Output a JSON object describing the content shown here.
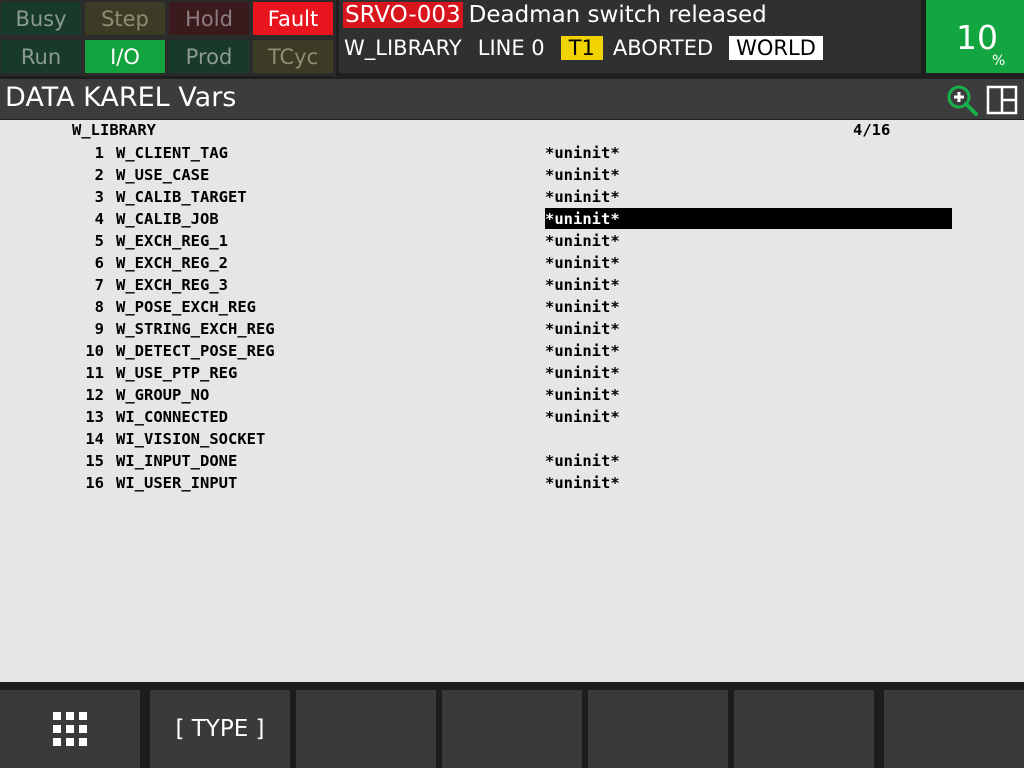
{
  "lamps": [
    {
      "label": "Busy",
      "state": "off"
    },
    {
      "label": "Step",
      "state": "off"
    },
    {
      "label": "Hold",
      "state": "off"
    },
    {
      "label": "Fault",
      "state": "on"
    },
    {
      "label": "Run",
      "state": "off"
    },
    {
      "label": "I/O",
      "state": "on"
    },
    {
      "label": "Prod",
      "state": "off"
    },
    {
      "label": "TCyc",
      "state": "off"
    }
  ],
  "alarm": {
    "code": "SRVO-003",
    "message": "Deadman switch released"
  },
  "status": {
    "program": "W_LIBRARY",
    "line": "LINE 0",
    "mode": "T1",
    "state": "ABORTED",
    "frame": "WORLD"
  },
  "override": {
    "value": "10",
    "unit": "%"
  },
  "title": "DATA KAREL Vars",
  "icons": {
    "zoom": "zoom-in-icon",
    "split": "split-screen-icon",
    "menu": "grid-menu-icon"
  },
  "colors": {
    "fault": "#e8151e",
    "io": "#12a33f",
    "override": "#13a53f",
    "mode_badge": "#f0d300",
    "alarm_code": "#d8141c"
  },
  "listing": {
    "program": "W_LIBRARY",
    "position": "4/16",
    "selected_index": 4,
    "rows": [
      {
        "num": "1",
        "name": "W_CLIENT_TAG",
        "value": "*uninit*"
      },
      {
        "num": "2",
        "name": "W_USE_CASE",
        "value": "*uninit*"
      },
      {
        "num": "3",
        "name": "W_CALIB_TARGET",
        "value": "*uninit*"
      },
      {
        "num": "4",
        "name": "W_CALIB_JOB",
        "value": "*uninit*"
      },
      {
        "num": "5",
        "name": "W_EXCH_REG_1",
        "value": "*uninit*"
      },
      {
        "num": "6",
        "name": "W_EXCH_REG_2",
        "value": "*uninit*"
      },
      {
        "num": "7",
        "name": "W_EXCH_REG_3",
        "value": "*uninit*"
      },
      {
        "num": "8",
        "name": "W_POSE_EXCH_REG",
        "value": "*uninit*"
      },
      {
        "num": "9",
        "name": "W_STRING_EXCH_REG",
        "value": "*uninit*"
      },
      {
        "num": "10",
        "name": "W_DETECT_POSE_REG",
        "value": "*uninit*"
      },
      {
        "num": "11",
        "name": "W_USE_PTP_REG",
        "value": "*uninit*"
      },
      {
        "num": "12",
        "name": "W_GROUP_NO",
        "value": "*uninit*"
      },
      {
        "num": "13",
        "name": "WI_CONNECTED",
        "value": "*uninit*"
      },
      {
        "num": "14",
        "name": "WI_VISION_SOCKET",
        "value": ""
      },
      {
        "num": "15",
        "name": "WI_INPUT_DONE",
        "value": "*uninit*"
      },
      {
        "num": "16",
        "name": "WI_USER_INPUT",
        "value": "*uninit*"
      }
    ]
  },
  "function_keys": [
    "",
    "[ TYPE ]",
    "",
    "",
    "",
    "",
    ""
  ]
}
